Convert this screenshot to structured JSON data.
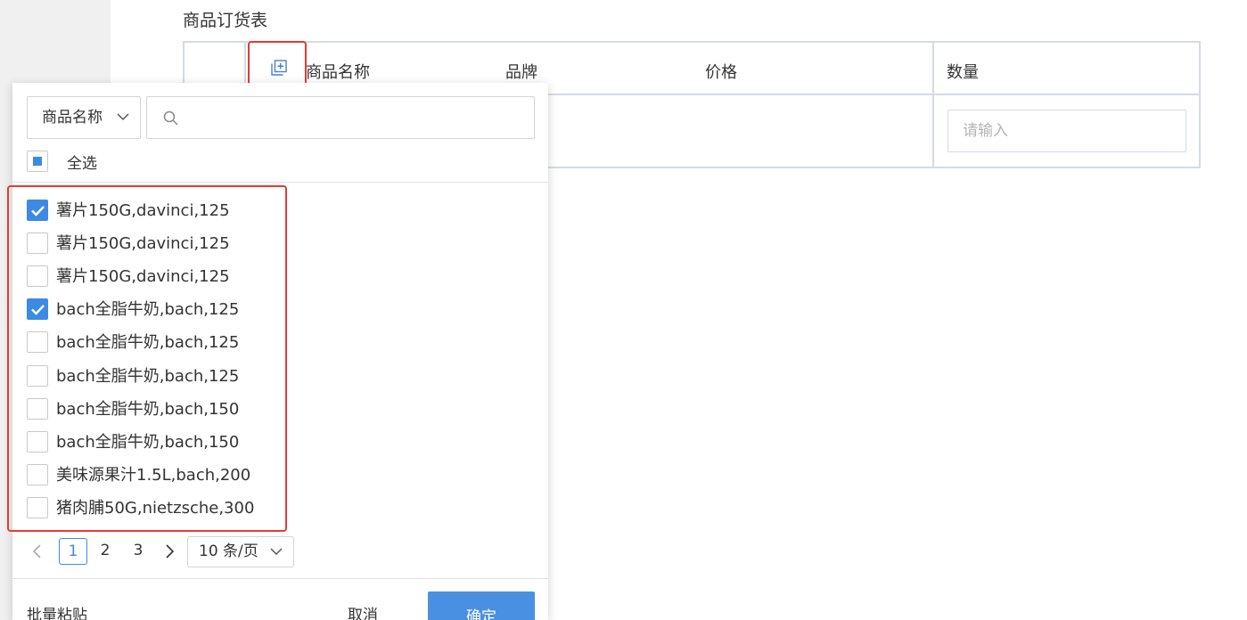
{
  "page": {
    "title": "商品订货表"
  },
  "table": {
    "headers": {
      "name": "商品名称",
      "brand": "品牌",
      "price": "价格",
      "qty": "数量"
    },
    "qty_placeholder": "请输入"
  },
  "panel": {
    "field_select": "商品名称",
    "search_placeholder": "",
    "select_all_label": "全选",
    "items": [
      {
        "text": "薯片150G,davinci,125",
        "checked": true
      },
      {
        "text": "薯片150G,davinci,125",
        "checked": false
      },
      {
        "text": "薯片150G,davinci,125",
        "checked": false
      },
      {
        "text": "bach全脂牛奶,bach,125",
        "checked": true
      },
      {
        "text": "bach全脂牛奶,bach,125",
        "checked": false
      },
      {
        "text": "bach全脂牛奶,bach,125",
        "checked": false
      },
      {
        "text": "bach全脂牛奶,bach,150",
        "checked": false
      },
      {
        "text": "bach全脂牛奶,bach,150",
        "checked": false
      },
      {
        "text": "美味源果汁1.5L,bach,200",
        "checked": false
      },
      {
        "text": "猪肉脯50G,nietzsche,300",
        "checked": false
      }
    ],
    "pager": {
      "pages": [
        "1",
        "2",
        "3"
      ],
      "current": "1",
      "page_size": "10 条/页"
    },
    "bulk_paste": "批量粘贴",
    "cancel": "取消",
    "ok": "确定"
  },
  "colors": {
    "primary": "#4a90e2",
    "highlight": "#e83a30",
    "border": "#d4dae6"
  }
}
